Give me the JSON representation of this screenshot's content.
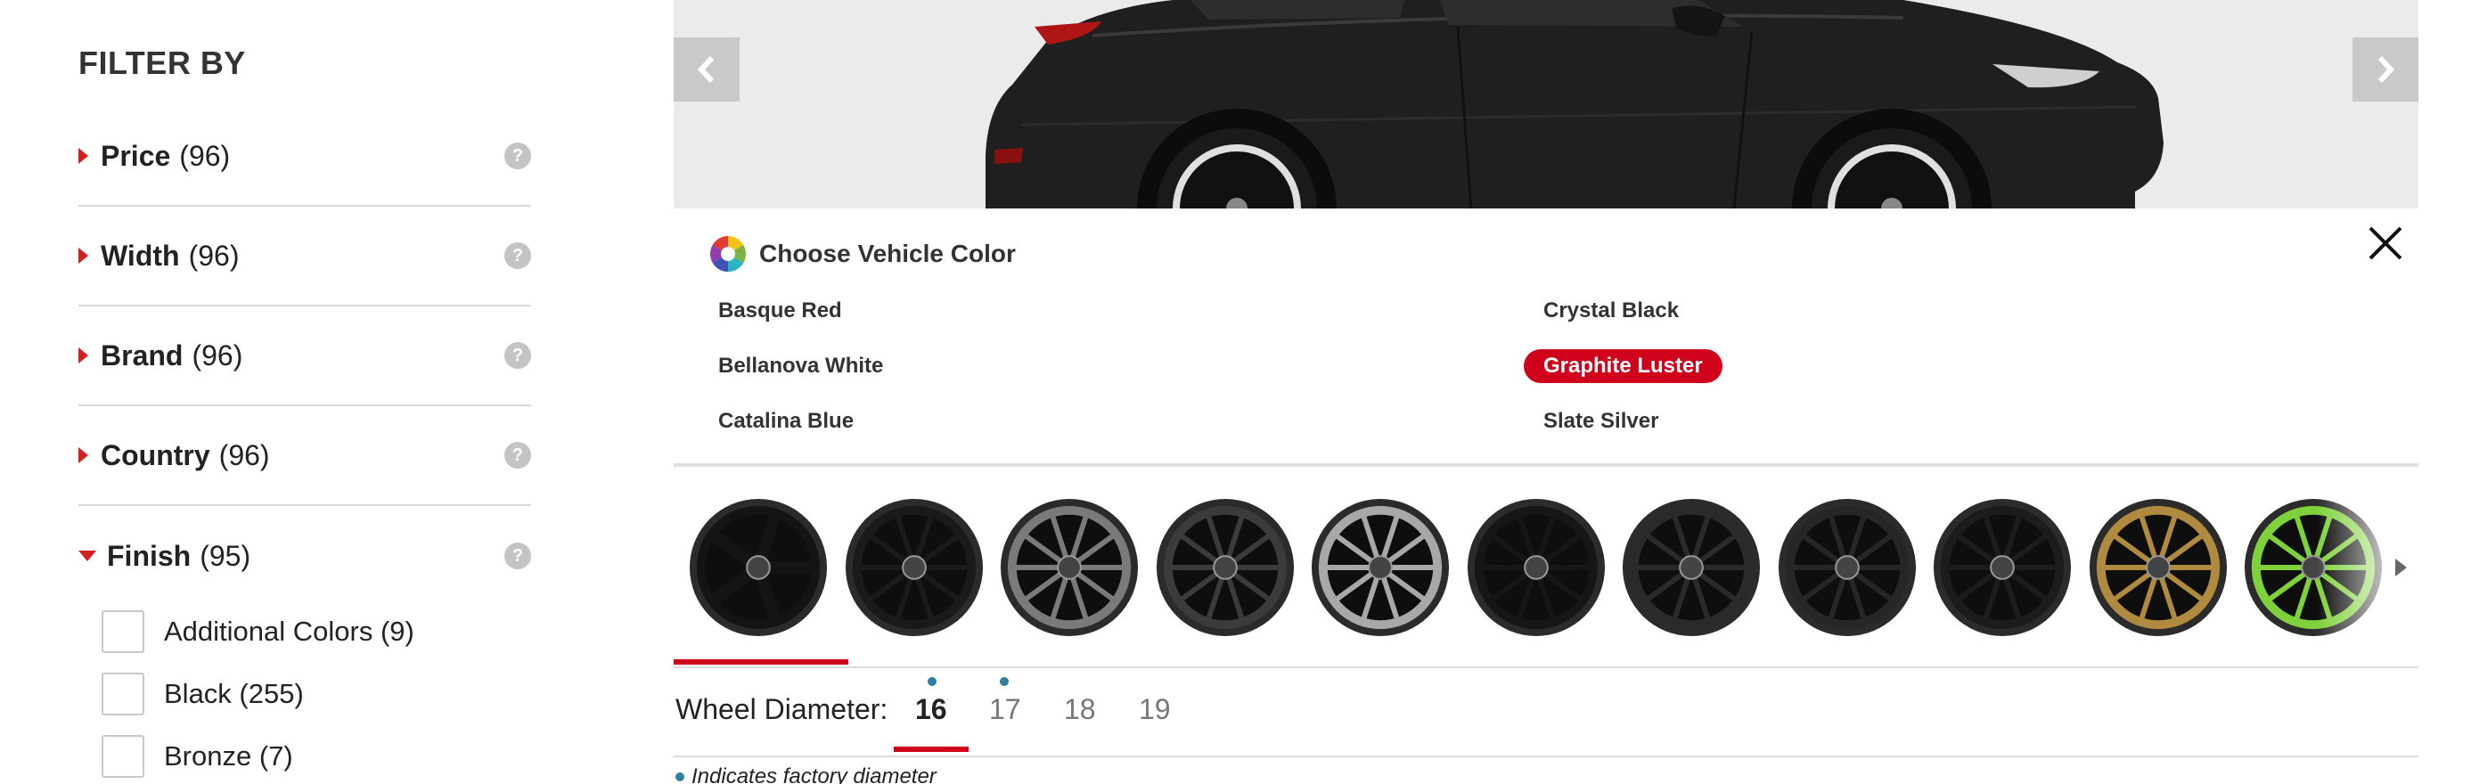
{
  "sidebar": {
    "heading": "FILTER BY",
    "filters": [
      {
        "name": "Price",
        "count": "(96)",
        "help": "?"
      },
      {
        "name": "Width",
        "count": "(96)",
        "help": "?"
      },
      {
        "name": "Brand",
        "count": "(96)",
        "help": "?"
      },
      {
        "name": "Country",
        "count": "(96)",
        "help": "?"
      },
      {
        "name": "Finish",
        "count": "(95)",
        "help": "?",
        "expanded": true
      }
    ],
    "finish_options": [
      {
        "label": "Additional Colors (9)",
        "checked": false
      },
      {
        "label": "Black (255)",
        "checked": false
      },
      {
        "label": "Bronze (7)",
        "checked": false
      }
    ]
  },
  "vehicle": {
    "prev_icon": "chevron-left-icon",
    "next_icon": "chevron-right-icon",
    "body_color": "#1f1f1f"
  },
  "color_chooser": {
    "title": "Choose Vehicle Color",
    "close_icon": "close-icon",
    "colors": [
      {
        "name": "Basque Red",
        "selected": false
      },
      {
        "name": "Crystal Black",
        "selected": false
      },
      {
        "name": "Bellanova White",
        "selected": false
      },
      {
        "name": "Graphite Luster",
        "selected": true
      },
      {
        "name": "Catalina Blue",
        "selected": false
      },
      {
        "name": "Slate Silver",
        "selected": false
      }
    ],
    "selected_color": "#d0021b"
  },
  "wheels": {
    "count_visible": 11,
    "selected_index": 0,
    "finishes": [
      "#141414",
      "#1a1a1a",
      "#7a7a7a",
      "#3b3b3b",
      "#a8a8a8",
      "#161616",
      "#2a2a2a",
      "#262626",
      "#1c1c1c",
      "#b08a3e",
      "#7fd13b"
    ],
    "next_icon": "caret-right-icon"
  },
  "diameter": {
    "label": "Wheel Diameter:",
    "options": [
      {
        "value": "16",
        "active": true,
        "factory": true
      },
      {
        "value": "17",
        "active": false,
        "factory": true
      },
      {
        "value": "18",
        "active": false,
        "factory": false
      },
      {
        "value": "19",
        "active": false,
        "factory": false
      }
    ],
    "legend": "Indicates factory diameter",
    "factory_dot_color": "#2e7fa0"
  }
}
